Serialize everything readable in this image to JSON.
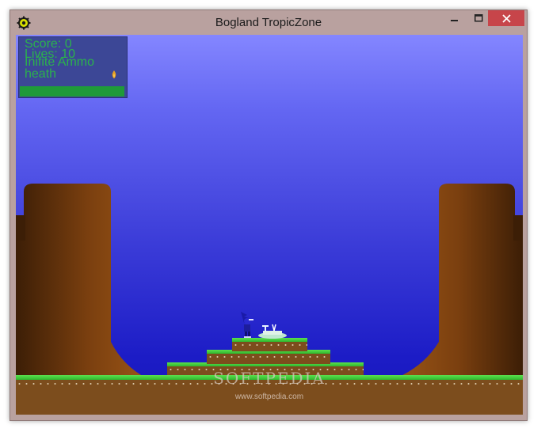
{
  "window": {
    "title": "Bogland TropicZone",
    "controls": [
      "minimize-icon",
      "maximize-icon",
      "close-icon"
    ],
    "close_color": "#c7454a",
    "frame_color": "#b9a19f"
  },
  "hud": {
    "score": "Score: 0",
    "lives": "Lives: 10",
    "ammo": "Inifite Ammo",
    "health_label": "heath",
    "health_fraction": 1.0,
    "health_color": "#1f9a3a"
  },
  "scene": {
    "sky_top": "#8486ff",
    "sky_bottom": "#1616b8",
    "grass_color": "#3ccc38",
    "dirt_color": "#7c4d1d",
    "tree_color": "#8a4a16"
  },
  "watermark": {
    "brand": "SOFTPEDIA",
    "url": "www.softpedia.com"
  }
}
